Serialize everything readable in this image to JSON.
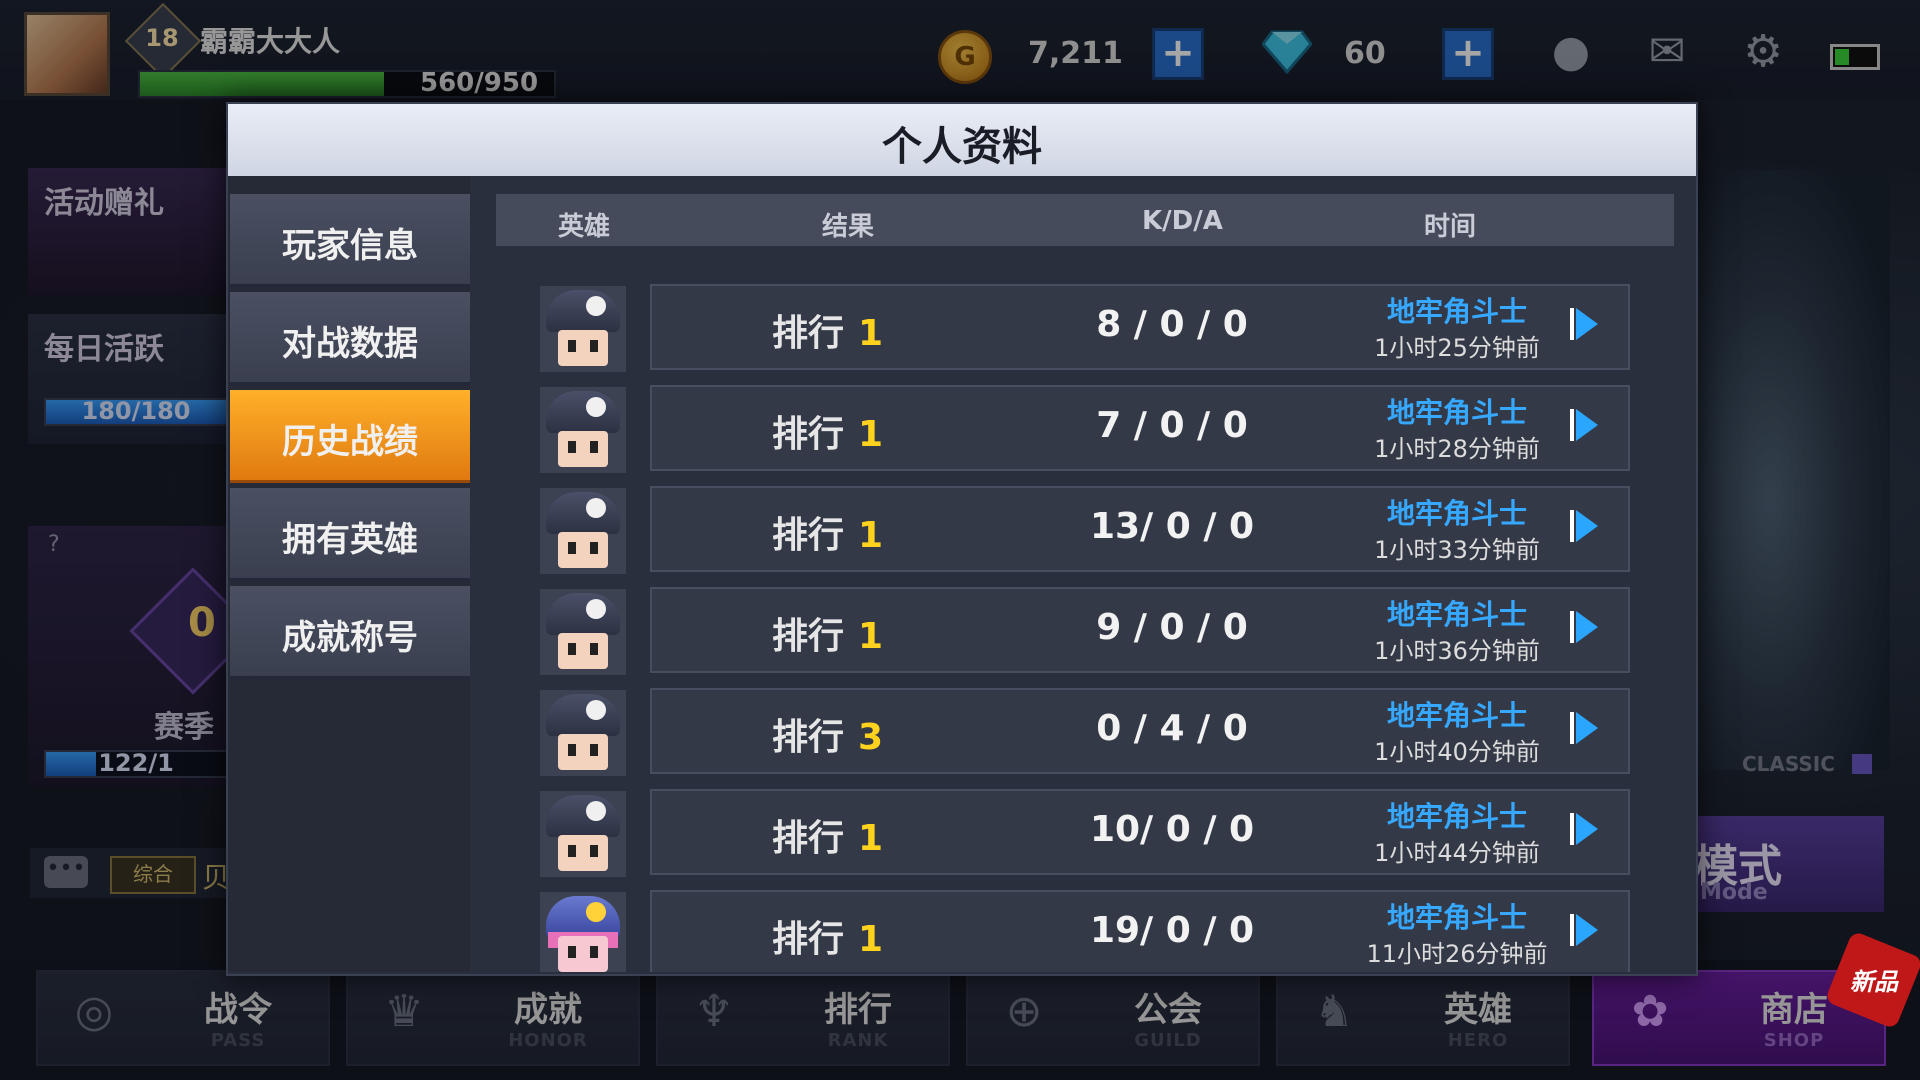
{
  "player": {
    "level": "18",
    "name": "霸霸大大人",
    "xp_text": "560/950",
    "xp_fraction": 0.589
  },
  "currency": {
    "coin_symbol": "G",
    "coins": "7,211",
    "gems": "60",
    "plus": "+"
  },
  "left_panel": {
    "event_gift": "活动赠礼",
    "daily_active": "每日活跃",
    "daily_progress": "180/180",
    "season_label": "赛季",
    "season_progress": "122/1",
    "season_rank": "0",
    "question": "?",
    "chat_tag": "综合",
    "chat_more": "贝"
  },
  "right_panel": {
    "classic": "CLASSIC",
    "mode_title": "模式",
    "mode_sub": "Mode"
  },
  "dialog": {
    "title": "个人资料",
    "tabs": [
      "玩家信息",
      "对战数据",
      "历史战绩",
      "拥有英雄",
      "成就称号"
    ],
    "active_tab": 2,
    "columns": [
      "英雄",
      "结果",
      "K/D/A",
      "时间"
    ],
    "rows": [
      {
        "rank_label": "排行",
        "rank": "1",
        "kda": "8 / 0 / 0",
        "mode": "地牢角斗士",
        "time": "1小时25分钟前"
      },
      {
        "rank_label": "排行",
        "rank": "1",
        "kda": "7 / 0 / 0",
        "mode": "地牢角斗士",
        "time": "1小时28分钟前"
      },
      {
        "rank_label": "排行",
        "rank": "1",
        "kda": "13/ 0 / 0",
        "mode": "地牢角斗士",
        "time": "1小时33分钟前"
      },
      {
        "rank_label": "排行",
        "rank": "1",
        "kda": "9 / 0 / 0",
        "mode": "地牢角斗士",
        "time": "1小时36分钟前"
      },
      {
        "rank_label": "排行",
        "rank": "3",
        "kda": "0 / 4 / 0",
        "mode": "地牢角斗士",
        "time": "1小时40分钟前"
      },
      {
        "rank_label": "排行",
        "rank": "1",
        "kda": "10/ 0 / 0",
        "mode": "地牢角斗士",
        "time": "1小时44分钟前"
      },
      {
        "rank_label": "排行",
        "rank": "1",
        "kda": "19/ 0 / 0",
        "mode": "地牢角斗士",
        "time": "11小时26分钟前"
      }
    ]
  },
  "bottom_nav": [
    {
      "label": "战令",
      "sub": "PASS",
      "icon": "pass-icon"
    },
    {
      "label": "成就",
      "sub": "HONOR",
      "icon": "honor-icon"
    },
    {
      "label": "排行",
      "sub": "RANK",
      "icon": "trophy-icon"
    },
    {
      "label": "公会",
      "sub": "GUILD",
      "icon": "guild-icon"
    },
    {
      "label": "英雄",
      "sub": "HERO",
      "icon": "helmet-icon"
    },
    {
      "label": "商店",
      "sub": "SHOP",
      "icon": "shop-icon"
    }
  ],
  "new_badge": "新品",
  "colors": {
    "accent_orange": "#f0961a",
    "mode_blue": "#36a8ff",
    "rank_yellow": "#ffd21e",
    "shop_purple": "#6a1fa0"
  }
}
